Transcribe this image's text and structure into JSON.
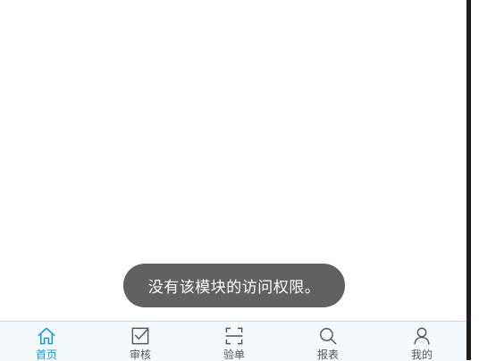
{
  "toast": {
    "message": "没有该模块的访问权限。"
  },
  "tabbar": {
    "accent_color": "#1a9ad6",
    "items": [
      {
        "label": "首页",
        "icon": "home-icon",
        "active": true
      },
      {
        "label": "审核",
        "icon": "checkbox-icon",
        "active": false
      },
      {
        "label": "验单",
        "icon": "scan-icon",
        "active": false
      },
      {
        "label": "报表",
        "icon": "search-icon",
        "active": false
      },
      {
        "label": "我的",
        "icon": "user-icon",
        "active": false
      }
    ]
  }
}
